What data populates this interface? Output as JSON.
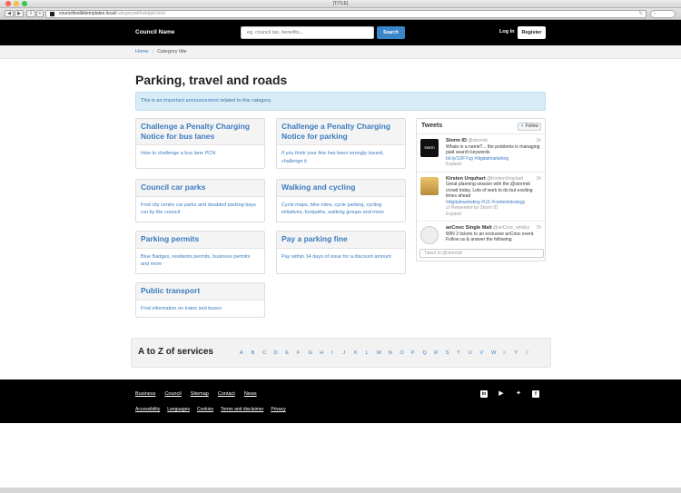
{
  "browser": {
    "title": "[TITLE]",
    "url_host": "counciltoolkittemplates.local",
    "url_path": "/categorywithwidget.html",
    "colors": {
      "close": "#fc605c",
      "minimize": "#fdbc40",
      "zoom": "#34c84a"
    }
  },
  "header": {
    "brand": "Council Name",
    "search_placeholder": "eg. council tax, benefits...",
    "search_button": "Search",
    "login": "Log In",
    "register": "Register"
  },
  "breadcrumb": {
    "home": "Home",
    "current": "Category title"
  },
  "page": {
    "title": "Parking, travel and roads",
    "announcement": {
      "before": "This is an ",
      "link": "important announcement",
      "after": " related to this category."
    }
  },
  "cards": [
    {
      "title": "Challenge a Penalty Charging Notice for bus lanes",
      "body": "How to challenge a bus lane PCN"
    },
    {
      "title": "Challenge a Penalty Charging Notice for parking",
      "body": "If you think your fine has been wrongly issued, challenge it"
    },
    {
      "title": "Council car parks",
      "body": "Find city centre car parks and disabled parking bays run by the council"
    },
    {
      "title": "Walking and cycling",
      "body": "Cycle maps, bike rides, cycle parking, cycling initiatives, footpaths, walking groups and more"
    },
    {
      "title": "Parking permits",
      "body": "Blue Badges, residents permits, business permits and more"
    },
    {
      "title": "Pay a parking fine",
      "body": "Pay within 14 days of issue for a discount amount"
    },
    {
      "title": "Public transport",
      "body": "Find information on trains and buses"
    }
  ],
  "tweets": {
    "title": "Tweets",
    "follow": "Follow",
    "compose_placeholder": "Tweet to @stormid",
    "items": [
      {
        "name": "Storm ID",
        "handle": "@stormid",
        "time": "1h",
        "avatar_text": "storm",
        "text": "Whats in a name?... the problems in managing paid search keywords",
        "link": "bit.ly/11fFYsg #digitalmarketing",
        "meta": "Expand",
        "retweet": ""
      },
      {
        "name": "Kirsten Urquhart",
        "handle": "@KirstenUrquhart",
        "time": "1h",
        "avatar_text": "",
        "text": "Great planning session with the @stormid crowd today. Lots of work to do but exciting times ahead",
        "link": "#digitalmarketing #UX #contentstrategy",
        "meta": "Expand",
        "retweet": "Retweeted by Storm ID"
      },
      {
        "name": "anCnoc Single Malt",
        "handle": "@anCnoc_whisky",
        "time": "7h",
        "avatar_text": "",
        "text": "WIN 2 tickets to an exclusive anCnoc event. Follow us & answer the following",
        "link": "",
        "meta": "",
        "retweet": ""
      }
    ]
  },
  "az": {
    "title": "A to Z of services",
    "letters": [
      "A",
      "B",
      "C",
      "D",
      "E",
      "F",
      "G",
      "H",
      "I",
      "J",
      "K",
      "L",
      "M",
      "N",
      "O",
      "P",
      "Q",
      "R",
      "S",
      "T",
      "U",
      "V",
      "W",
      "X",
      "Y",
      "Z"
    ],
    "muted": [
      "X",
      "Z"
    ]
  },
  "footer": {
    "primary": [
      "Business",
      "Council",
      "Sitemap",
      "Contact",
      "News"
    ],
    "secondary": [
      "Accessibility",
      "Languages",
      "Cookies",
      "Terms and disclaimer",
      "Privacy"
    ],
    "social_icons": [
      "linkedin-icon",
      "youtube-icon",
      "twitter-icon",
      "facebook-icon"
    ]
  }
}
